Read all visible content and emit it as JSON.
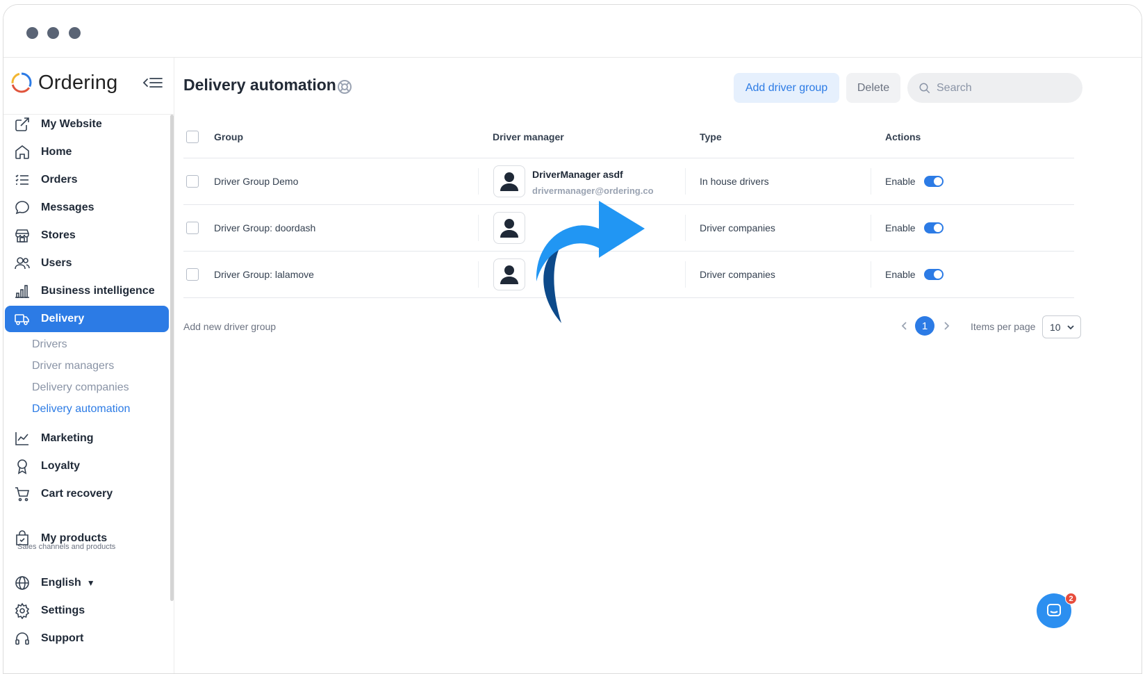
{
  "window": {
    "controls": [
      "close",
      "minimize",
      "maximize"
    ]
  },
  "brand": {
    "name": "Ordering",
    "logo_colors": [
      "#e0543c",
      "#2c7be5",
      "#f2b632"
    ]
  },
  "sidebar": {
    "items": [
      {
        "label": "My Website",
        "icon": "external-link-icon"
      },
      {
        "label": "Home",
        "icon": "home-icon"
      },
      {
        "label": "Orders",
        "icon": "list-icon"
      },
      {
        "label": "Messages",
        "icon": "chat-bubble-icon"
      },
      {
        "label": "Stores",
        "icon": "store-icon"
      },
      {
        "label": "Users",
        "icon": "users-icon"
      },
      {
        "label": "Business intelligence",
        "icon": "bar-chart-icon"
      },
      {
        "label": "Delivery",
        "icon": "truck-icon",
        "active": true
      }
    ],
    "delivery_sub": [
      "Drivers",
      "Driver managers",
      "Delivery companies",
      "Delivery automation"
    ],
    "items_after": [
      {
        "label": "Marketing",
        "icon": "trend-icon"
      },
      {
        "label": "Loyalty",
        "icon": "award-icon"
      },
      {
        "label": "Cart recovery",
        "icon": "cart-icon"
      }
    ],
    "section_caption": "Sales channels and products",
    "products": {
      "label": "My products",
      "icon": "bag-icon"
    },
    "language": {
      "label": "English",
      "icon": "globe-icon"
    },
    "settings": {
      "label": "Settings",
      "icon": "gear-icon"
    },
    "support": {
      "label": "Support",
      "icon": "headset-icon"
    }
  },
  "header": {
    "title": "Delivery automation",
    "add_button": "Add driver group",
    "delete_button": "Delete",
    "search_placeholder": "Search"
  },
  "table": {
    "columns": [
      "Group",
      "Driver manager",
      "Type",
      "Actions"
    ],
    "rows": [
      {
        "group": "Driver Group Demo",
        "manager_name": "DriverManager asdf",
        "manager_email": "drivermanager@ordering.co",
        "type": "In house drivers",
        "action": "Enable",
        "enabled": true
      },
      {
        "group": "Driver Group: doordash",
        "manager_name": "",
        "manager_email": "",
        "type": "Driver companies",
        "action": "Enable",
        "enabled": true
      },
      {
        "group": "Driver Group: lalamove",
        "manager_name": "",
        "manager_email": "",
        "type": "Driver companies",
        "action": "Enable",
        "enabled": true
      }
    ]
  },
  "footer": {
    "add_link": "Add new driver group",
    "current_page": "1",
    "items_per_page_label": "Items per page",
    "items_per_page": "10"
  },
  "chat": {
    "badge": "2"
  },
  "colors": {
    "accent": "#2c7be5",
    "arrow": "#2196f3",
    "arrow_dark": "#0d4a8a"
  }
}
